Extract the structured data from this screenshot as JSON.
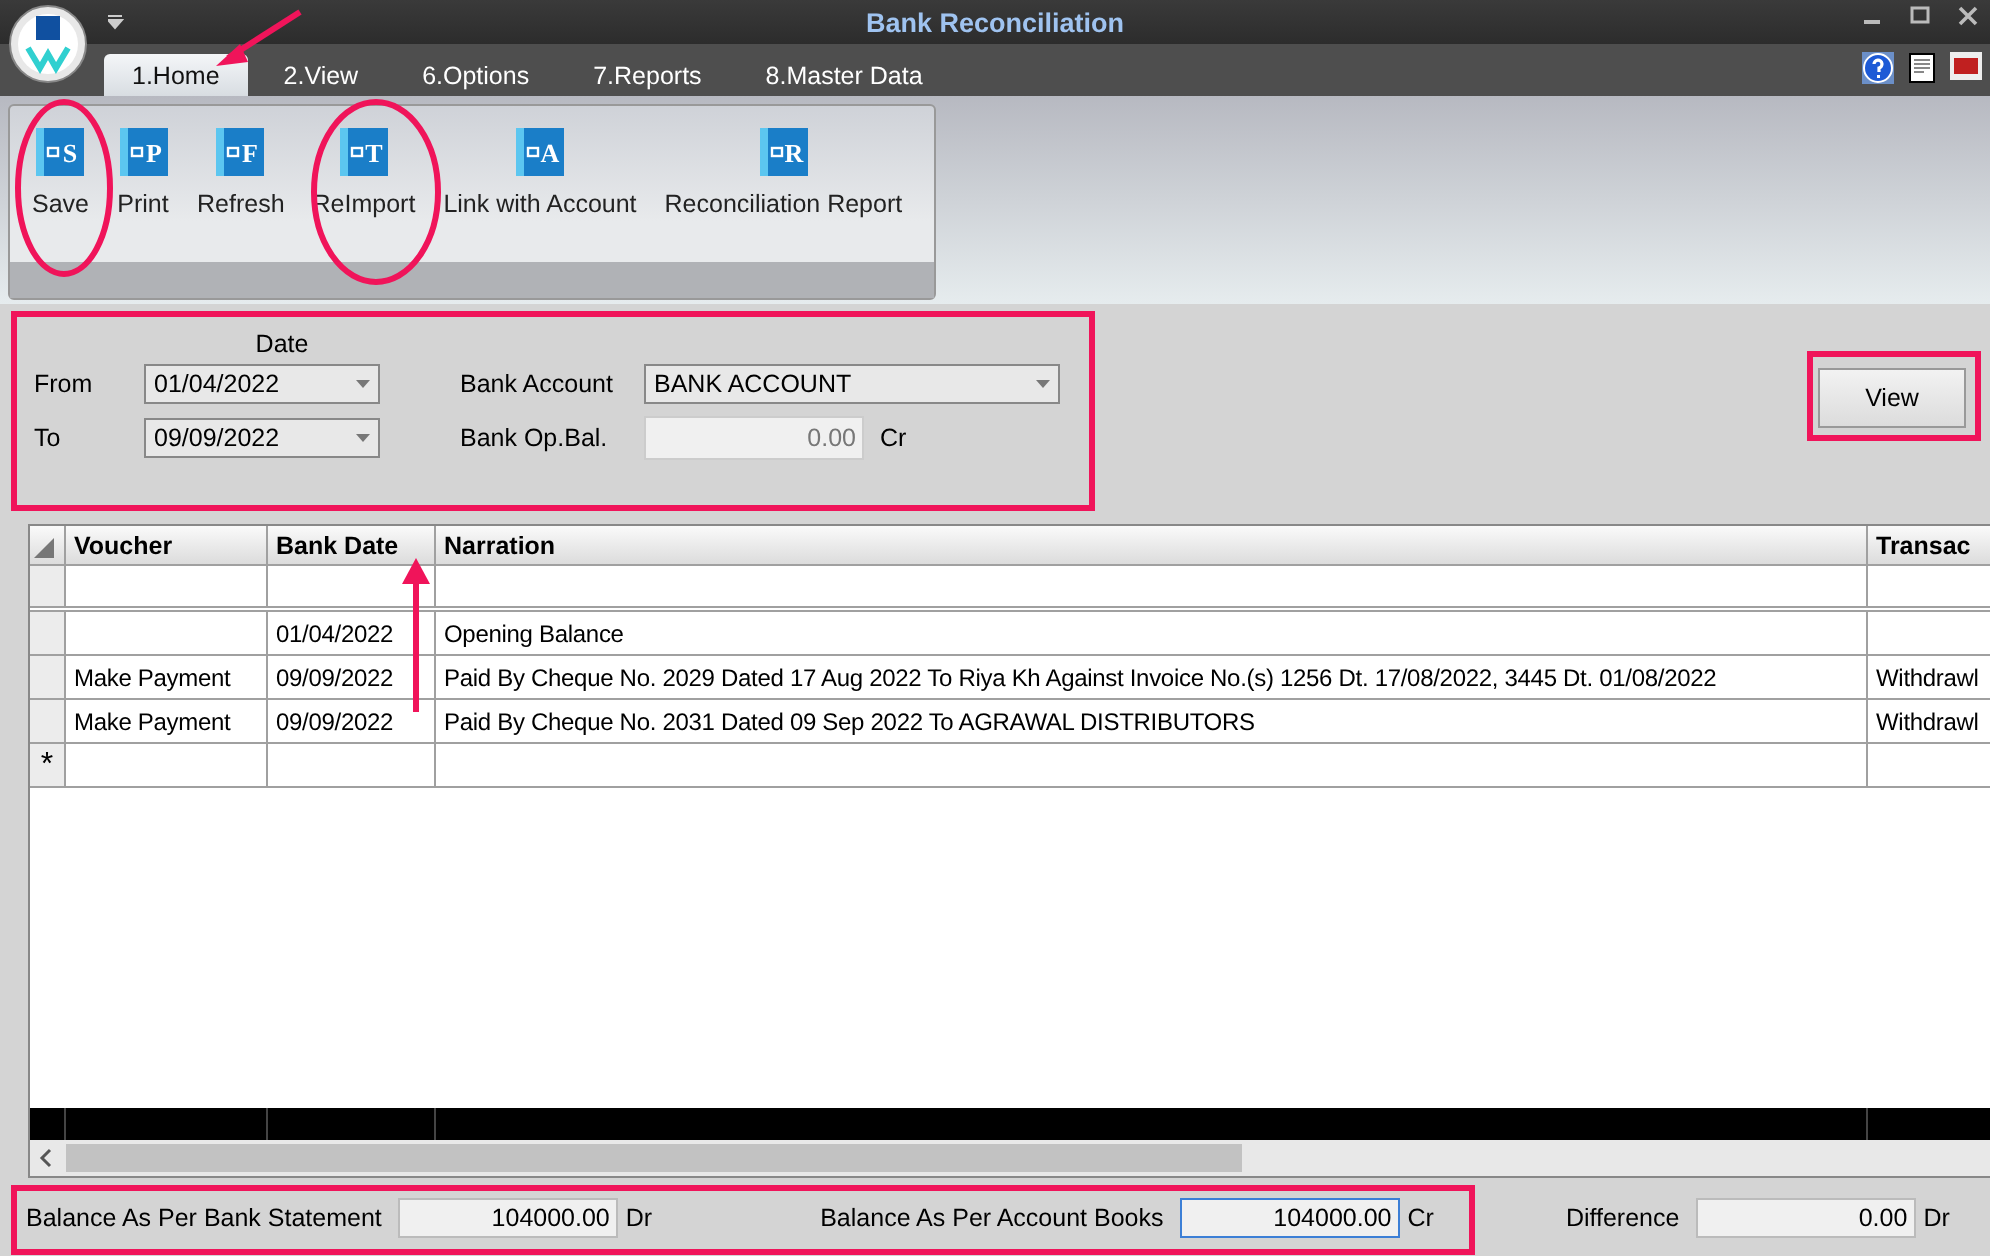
{
  "window": {
    "title": "Bank Reconciliation"
  },
  "tabs": [
    {
      "label": "1.Home",
      "selected": true
    },
    {
      "label": "2.View",
      "selected": false
    },
    {
      "label": "6.Options",
      "selected": false
    },
    {
      "label": "7.Reports",
      "selected": false
    },
    {
      "label": "8.Master Data",
      "selected": false
    }
  ],
  "toolbar": [
    {
      "label": "Save",
      "icon_letter": "S"
    },
    {
      "label": "Print",
      "icon_letter": "P"
    },
    {
      "label": "Refresh",
      "icon_letter": "F"
    },
    {
      "label": "ReImport",
      "icon_letter": "T"
    },
    {
      "label": "Link with Account",
      "icon_letter": "A"
    },
    {
      "label": "Reconciliation Report",
      "icon_letter": "R"
    }
  ],
  "filter": {
    "date_header": "Date",
    "from_label": "From",
    "from_value": "01/04/2022",
    "to_label": "To",
    "to_value": "09/09/2022",
    "bank_account_label": "Bank Account",
    "bank_account_value": "BANK ACCOUNT",
    "op_bal_label": "Bank Op.Bal.",
    "op_bal_value": "0.00",
    "op_bal_suffix": "Cr",
    "view_button": "View"
  },
  "table": {
    "columns": [
      "Voucher",
      "Bank Date",
      "Narration",
      "Transac"
    ],
    "rows": [
      [
        "",
        "01/04/2022",
        "Opening Balance",
        ""
      ],
      [
        "Make Payment",
        "09/09/2022",
        "Paid By Cheque No. 2029 Dated 17 Aug 2022 To Riya Kh  Against Invoice No.(s) 1256 Dt. 17/08/2022, 3445 Dt. 01/08/2022",
        "Withdrawl"
      ],
      [
        "Make Payment",
        "09/09/2022",
        "Paid By Cheque No. 2031 Dated 09 Sep 2022 To AGRAWAL DISTRIBUTORS",
        "Withdrawl"
      ]
    ],
    "new_row_marker": "*"
  },
  "footer": [
    {
      "label": "Balance As Per Bank Statement",
      "value": "104000.00",
      "suffix": "Dr",
      "focused": false
    },
    {
      "label": "Balance As Per Account Books",
      "value": "104000.00",
      "suffix": "Cr",
      "focused": true
    },
    {
      "label": "Difference",
      "value": "0.00",
      "suffix": "Dr",
      "focused": false
    }
  ]
}
